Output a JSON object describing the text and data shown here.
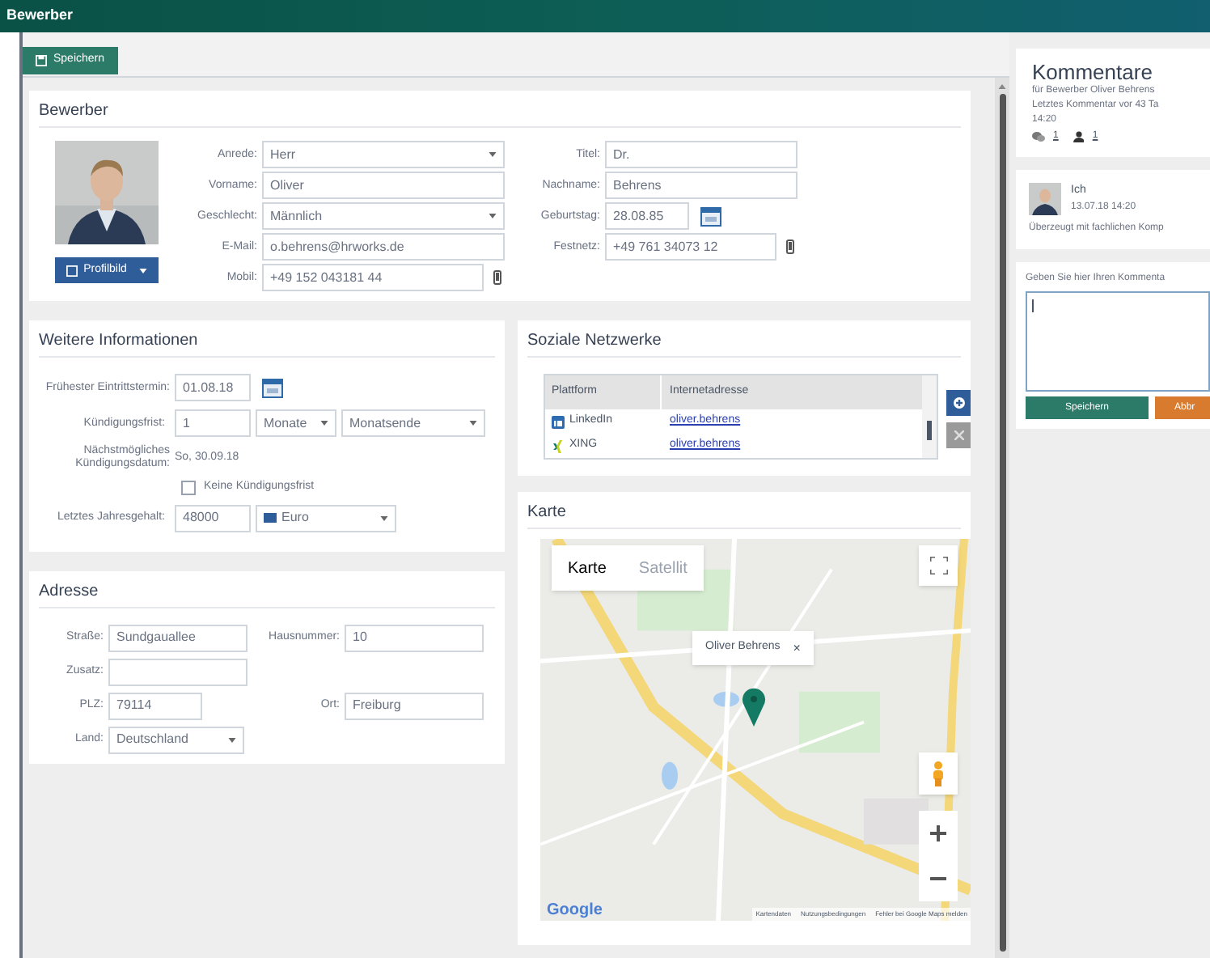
{
  "window": {
    "title": "Bewerber"
  },
  "toolbar": {
    "save_button": "Speichern"
  },
  "applicant": {
    "heading": "Bewerber",
    "profile_button": "Profilbild",
    "left_fields": [
      {
        "label": "Anrede:",
        "value": "Herr",
        "kind": "select"
      },
      {
        "label": "Vorname:",
        "value": "Oliver",
        "kind": "text"
      },
      {
        "label": "Geschlecht:",
        "value": "Männlich",
        "kind": "select"
      },
      {
        "label": "E-Mail:",
        "value": "o.behrens@hrworks.de",
        "kind": "text"
      },
      {
        "label": "Mobil:",
        "value": "+49 152 043181 44",
        "kind": "phone"
      }
    ],
    "right_fields": [
      {
        "label": "Titel:",
        "value": "Dr.",
        "kind": "text"
      },
      {
        "label": "Nachname:",
        "value": "Behrens",
        "kind": "text"
      },
      {
        "label": "Geburtstag:",
        "value": "28.08.85",
        "kind": "date"
      },
      {
        "label": "Festnetz:",
        "value": "+49 761 34073 12",
        "kind": "phone"
      }
    ]
  },
  "further_info": {
    "heading": "Weitere Informationen",
    "start_date": {
      "label": "Frühester Eintrittstermin:",
      "value": "01.08.18"
    },
    "notice": {
      "label": "Kündigungsfrist:",
      "value": "1",
      "unit": "Monate",
      "end": "Monatsende"
    },
    "next_date": {
      "label": "Nächstmögliches Kündigungsdatum:",
      "value": "So, 30.09.18"
    },
    "no_notice": {
      "label": "Keine Kündigungsfrist",
      "checked": false
    },
    "salary": {
      "label": "Letztes Jahresgehalt:",
      "value": "48000",
      "currency": "Euro"
    }
  },
  "address": {
    "heading": "Adresse",
    "street": {
      "label": "Straße:",
      "value": "Sundgauallee"
    },
    "house_number": {
      "label": "Hausnummer:",
      "value": "10"
    },
    "addition": {
      "label": "Zusatz:"
    },
    "zip": {
      "label": "PLZ:",
      "value": "79114"
    },
    "city": {
      "label": "Ort:",
      "value": "Freiburg"
    },
    "country": {
      "label": "Land:",
      "value": "Deutschland"
    }
  },
  "social": {
    "heading": "Soziale Netzwerke",
    "table": {
      "columns": [
        "Plattform",
        "Internetadresse"
      ],
      "rows": [
        {
          "platform": "LinkedIn",
          "address": "oliver.behrens",
          "kind": "linkedin"
        },
        {
          "platform": "XING",
          "address": "oliver.behrens",
          "kind": "xing"
        }
      ]
    }
  },
  "map": {
    "heading": "Karte",
    "tabs": [
      {
        "label": "Karte",
        "selected": true
      },
      {
        "label": "Satellit",
        "selected": false
      }
    ],
    "popup": {
      "title": "Oliver Behrens",
      "close": "×"
    },
    "logo": "Google",
    "attribution": [
      "Kartendaten",
      "Nutzungsbedingungen",
      "Fehler bei Google Maps melden"
    ]
  },
  "comments": {
    "title": "Kommentare",
    "subtitle": "für Bewerber Oliver Behrens",
    "last": "Letztes Kommentar vor 43 Ta",
    "time": "14:20",
    "comment_count": "1",
    "user_count": "1",
    "items": [
      {
        "author": "Ich",
        "date": "13.07.18 14:20",
        "text": "Überzeugt mit fachlichen Komp"
      }
    ],
    "input_label": "Geben Sie hier Ihren Kommenta",
    "save_button": "Speichern",
    "cancel_button": "Abbr"
  }
}
